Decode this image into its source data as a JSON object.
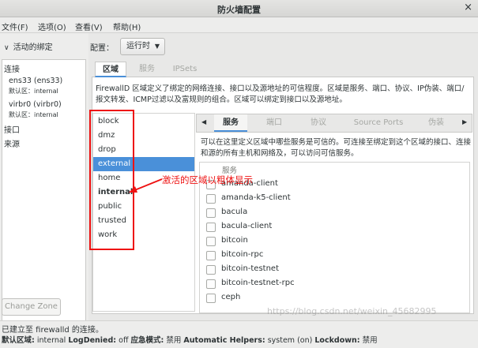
{
  "window": {
    "title": "防火墙配置",
    "close": "×"
  },
  "menu": [
    "文件(F)",
    "选项(O)",
    "查看(V)",
    "帮助(H)"
  ],
  "left": {
    "header": "活动的绑定",
    "connections_label": "连接",
    "connections": [
      {
        "device": "ens33 (ens33)",
        "zone": "默认区：internal"
      },
      {
        "device": "virbr0 (virbr0)",
        "zone": "默认区：internal"
      }
    ],
    "interfaces_label": "接口",
    "sources_label": "来源",
    "change_zone": "Change Zone"
  },
  "config": {
    "label": "配置：",
    "value": "运行时"
  },
  "tabs": [
    "区域",
    "服务",
    "IPSets"
  ],
  "zone_description": "FirewallD 区域定义了绑定的网络连接、接口以及源地址的可信程度。区域是服务、端口、协议、IP伪装、端口/报文转发、ICMP过滤以及富规则的组合。区域可以绑定到接口以及源地址。",
  "zones": [
    "block",
    "dmz",
    "drop",
    "external",
    "home",
    "internal",
    "public",
    "trusted",
    "work"
  ],
  "selected_zone": "external",
  "active_zone": "internal",
  "service_tabs": [
    "服务",
    "端口",
    "协议",
    "Source Ports",
    "伪装"
  ],
  "service_description": "可以在这里定义区域中哪些服务是可信的。可连接至绑定到这个区域的接口、连接和源的所有主机和网络及，可以访问可信服务。",
  "services_header": "服务",
  "services": [
    "amanda-client",
    "amanda-k5-client",
    "bacula",
    "bacula-client",
    "bitcoin",
    "bitcoin-rpc",
    "bitcoin-testnet",
    "bitcoin-testnet-rpc",
    "ceph"
  ],
  "annotation": "激活的区域以粗体显示",
  "status": "已建立至 firewalld 的连接。",
  "bottom": {
    "default_zone_label": "默认区域:",
    "default_zone": "internal",
    "logdenied_label": "LogDenied:",
    "logdenied": "off",
    "panic_label": "应急模式:",
    "panic": "禁用",
    "helpers_label": "Automatic Helpers:",
    "helpers": "system (on)",
    "lockdown_label": "Lockdown:",
    "lockdown": "禁用"
  },
  "watermark": "https://blog.csdn.net/weixin_45682995",
  "colors": {
    "accent": "#4a90d9",
    "annotation": "#ee1111"
  }
}
